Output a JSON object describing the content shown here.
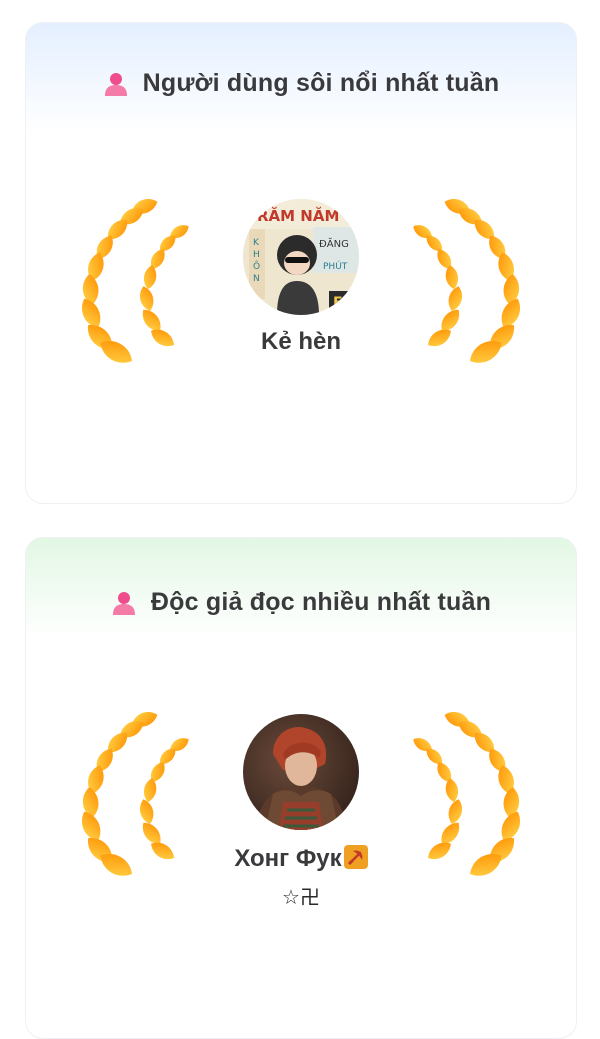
{
  "sections": [
    {
      "title": "Người dùng sôi nổi nhất tuần",
      "icon": "user-icon",
      "header_color": "#e4efff",
      "user": {
        "name": "Kẻ hèn",
        "avatar": "avatar-image"
      }
    },
    {
      "title": "Độc giả đọc nhiều nhất tuần",
      "icon": "user-icon",
      "header_color": "#e2f7e4",
      "user": {
        "name": "Хонг Фук",
        "badge": "☆卍",
        "avatar": "avatar-image"
      }
    }
  ],
  "colors": {
    "wreath_gold": "#ffb300",
    "wreath_orange": "#ff8a00",
    "icon_pink": "#ee4c8a"
  }
}
